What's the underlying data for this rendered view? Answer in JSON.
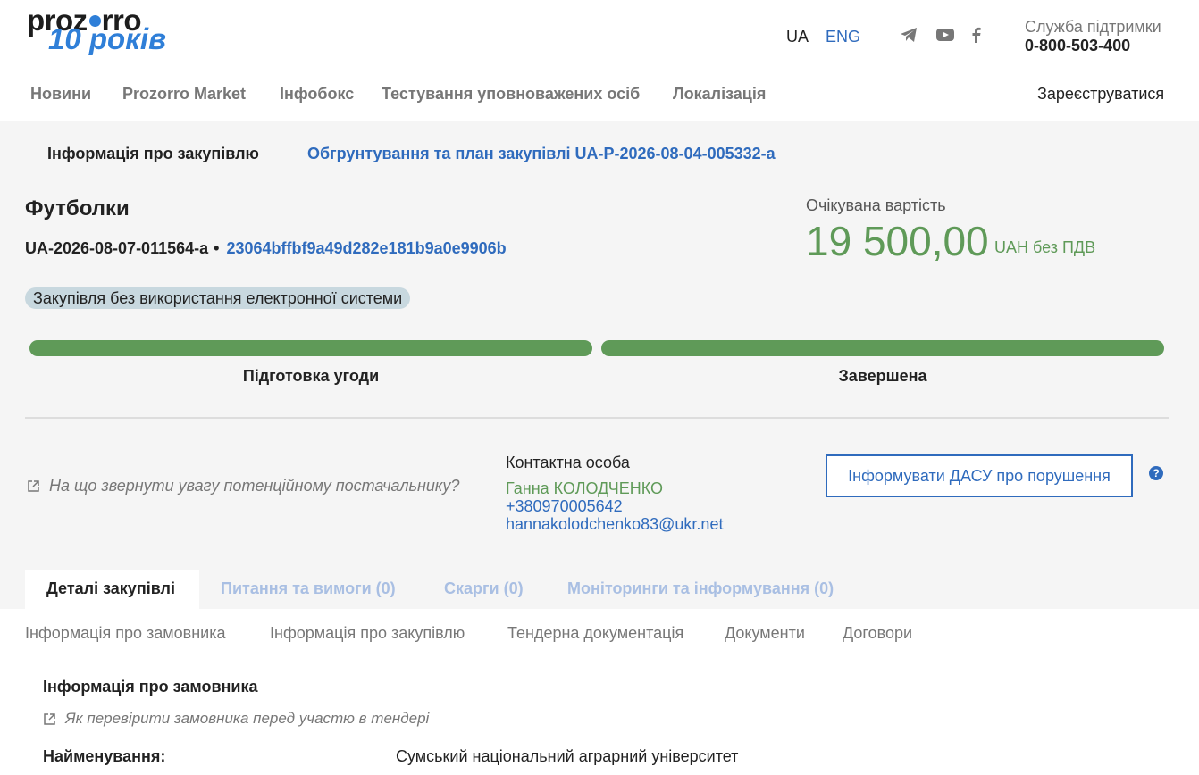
{
  "header": {
    "logo": {
      "brand": "prozorro",
      "tagline": "10 років"
    },
    "lang": {
      "ua": "UA",
      "eng": "ENG"
    },
    "social": [
      "telegram-icon",
      "youtube-icon",
      "facebook-icon"
    ],
    "support": {
      "label": "Служба підтримки",
      "phone": "0-800-503-400"
    },
    "nav": [
      "Новини",
      "Prozorro Market",
      "Інфобокс",
      "Тестування уповноважених осіб",
      "Локалізація"
    ],
    "register": "Зареєструватися"
  },
  "breadcrumbs": {
    "current": "Інформація про закупівлю",
    "plan_link": "Обгрунтування та план закупівлі UA-P-2026-08-04-005332-a"
  },
  "tender": {
    "title": "Футболки",
    "id": "UA-2026-08-07-011564-a",
    "bullet": "•",
    "hash": "23064bffbf9a49d282e181b9a0e9906b",
    "badge": "Закупівля без використання електронної системи"
  },
  "value": {
    "label": "Очікувана вартість",
    "amount": "19 500,00",
    "currency": "UAH без ПДВ"
  },
  "progress": {
    "stages": [
      {
        "label": "Підготовка угоди",
        "fill": 1.0
      },
      {
        "label": "Завершена",
        "fill": 1.0
      }
    ],
    "color": "#5f9a58"
  },
  "supplier_hint": "На що звернути увагу потенційному постачальнику?",
  "contact": {
    "label": "Контактна особа",
    "name": "Ганна КОЛОДЧЕНКО",
    "phone": "+380970005642",
    "email": "hannakolodchenko83@ukr.net"
  },
  "report_button": "Інформувати ДАСУ про порушення",
  "help_mark": "?",
  "tabs": [
    "Деталі закупівлі",
    "Питання та вимоги (0)",
    "Скарги (0)",
    "Моніторинги та інформування (0)"
  ],
  "subnav": [
    "Інформація про замовника",
    "Інформація про закупівлю",
    "Тендерна документація",
    "Документи",
    "Договори"
  ],
  "customer": {
    "section_title": "Інформація про замовника",
    "hint": "Як перевірити замовника перед участю в тендері",
    "name_label": "Найменування:",
    "name_value": "Сумський національний аграрний університет"
  },
  "colors": {
    "accent_blue": "#2f6bbd",
    "green": "#5f9a58",
    "tab_inactive": "#a9bfe3"
  }
}
